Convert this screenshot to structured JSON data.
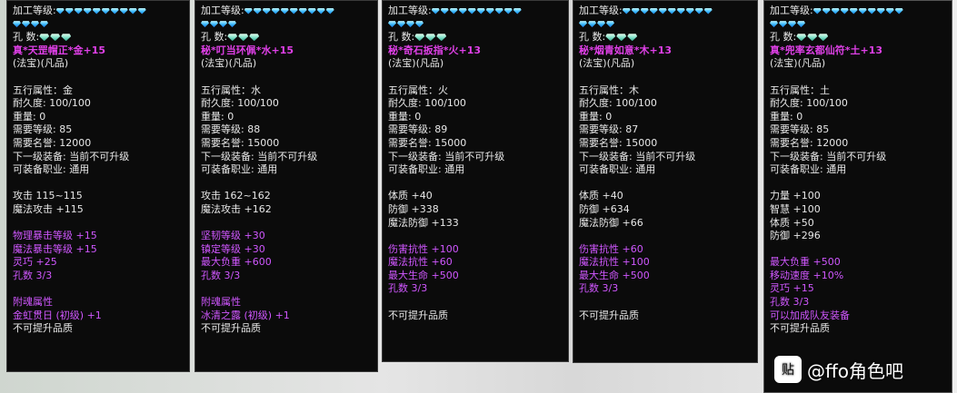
{
  "panels": [
    {
      "gem_count_row1": 10,
      "gem_count_row2": 4,
      "hole_gems": 3,
      "lines": [
        {
          "t": "加工等级:",
          "gems": "top"
        },
        {
          "t": "",
          "gems": "top2"
        },
        {
          "t": "孔    数:",
          "gems": "hole"
        },
        {
          "t": "真*天罡帽正*金+15",
          "c": "name"
        },
        {
          "t": "(法宝)(凡品)"
        },
        {
          "t": ""
        },
        {
          "t": "五行属性：金"
        },
        {
          "t": "耐久度: 100/100"
        },
        {
          "t": "重量: 0"
        },
        {
          "t": "需要等级: 85"
        },
        {
          "t": "需要名誉: 12000"
        },
        {
          "t": "下一级装备: 当前不可升级"
        },
        {
          "t": "可装备职业: 通用"
        },
        {
          "t": ""
        },
        {
          "t": "攻击 115~115"
        },
        {
          "t": "魔法攻击 +115"
        },
        {
          "t": ""
        },
        {
          "t": "物理暴击等级 +15",
          "c": "purple"
        },
        {
          "t": "魔法暴击等级 +15",
          "c": "purple"
        },
        {
          "t": "灵巧        +25",
          "c": "purple"
        },
        {
          "t": "孔数 3/3",
          "c": "purple"
        },
        {
          "t": ""
        },
        {
          "t": "附魂属性",
          "c": "purple"
        },
        {
          "t": "  金虹贯日 (初级) +1",
          "c": "purple"
        },
        {
          "t": "不可提升品质"
        }
      ]
    },
    {
      "gem_count_row1": 10,
      "gem_count_row2": 4,
      "hole_gems": 3,
      "lines": [
        {
          "t": "加工等级:",
          "gems": "top"
        },
        {
          "t": "",
          "gems": "top2"
        },
        {
          "t": "孔    数:",
          "gems": "hole"
        },
        {
          "t": "秘*叮当环佩*水+15",
          "c": "name"
        },
        {
          "t": "(法宝)(凡品)"
        },
        {
          "t": ""
        },
        {
          "t": "五行属性：水"
        },
        {
          "t": "耐久度: 100/100"
        },
        {
          "t": "重量: 0"
        },
        {
          "t": "需要等级: 88"
        },
        {
          "t": "需要名誉: 15000"
        },
        {
          "t": "下一级装备: 当前不可升级"
        },
        {
          "t": "可装备职业: 通用"
        },
        {
          "t": ""
        },
        {
          "t": "攻击 162~162"
        },
        {
          "t": "魔法攻击 +162"
        },
        {
          "t": ""
        },
        {
          "t": "坚韧等级 +30",
          "c": "purple"
        },
        {
          "t": "镇定等级 +30",
          "c": "purple"
        },
        {
          "t": "最大负重 +600",
          "c": "purple"
        },
        {
          "t": "孔数 3/3",
          "c": "purple"
        },
        {
          "t": ""
        },
        {
          "t": "附魂属性",
          "c": "purple"
        },
        {
          "t": "  冰清之露 (初级) +1",
          "c": "purple"
        },
        {
          "t": "不可提升品质"
        }
      ]
    },
    {
      "gem_count_row1": 10,
      "gem_count_row2": 4,
      "hole_gems": 3,
      "lines": [
        {
          "t": "加工等级:",
          "gems": "top"
        },
        {
          "t": "",
          "gems": "top2"
        },
        {
          "t": "孔    数:",
          "gems": "hole"
        },
        {
          "t": "秘*奇石扳指*火+13",
          "c": "name"
        },
        {
          "t": "(法宝)(凡品)"
        },
        {
          "t": ""
        },
        {
          "t": "五行属性：火"
        },
        {
          "t": "耐久度: 100/100"
        },
        {
          "t": "重量: 0"
        },
        {
          "t": "需要等级: 89"
        },
        {
          "t": "需要名誉: 15000"
        },
        {
          "t": "下一级装备: 当前不可升级"
        },
        {
          "t": "可装备职业: 通用"
        },
        {
          "t": ""
        },
        {
          "t": "体质 +40"
        },
        {
          "t": "防御 +338"
        },
        {
          "t": "魔法防御 +133"
        },
        {
          "t": ""
        },
        {
          "t": "伤害抗性 +100",
          "c": "purple"
        },
        {
          "t": "魔法抗性 +60",
          "c": "purple"
        },
        {
          "t": "最大生命 +500",
          "c": "purple"
        },
        {
          "t": "孔数 3/3",
          "c": "purple"
        },
        {
          "t": ""
        },
        {
          "t": "不可提升品质"
        }
      ]
    },
    {
      "gem_count_row1": 10,
      "gem_count_row2": 4,
      "hole_gems": 3,
      "lines": [
        {
          "t": "加工等级:",
          "gems": "top"
        },
        {
          "t": "",
          "gems": "top2"
        },
        {
          "t": "孔    数:",
          "gems": "hole"
        },
        {
          "t": "秘*烟青如意*木+13",
          "c": "name"
        },
        {
          "t": "(法宝)(凡品)"
        },
        {
          "t": ""
        },
        {
          "t": "五行属性：木"
        },
        {
          "t": "耐久度: 100/100"
        },
        {
          "t": "重量: 0"
        },
        {
          "t": "需要等级: 87"
        },
        {
          "t": "需要名誉: 15000"
        },
        {
          "t": "下一级装备: 当前不可升级"
        },
        {
          "t": "可装备职业: 通用"
        },
        {
          "t": ""
        },
        {
          "t": "体质 +40"
        },
        {
          "t": "防御 +634"
        },
        {
          "t": "魔法防御 +66"
        },
        {
          "t": ""
        },
        {
          "t": "伤害抗性 +60",
          "c": "purple"
        },
        {
          "t": "魔法抗性 +100",
          "c": "purple"
        },
        {
          "t": "最大生命 +500",
          "c": "purple"
        },
        {
          "t": "孔数 3/3",
          "c": "purple"
        },
        {
          "t": ""
        },
        {
          "t": "不可提升品质"
        }
      ]
    },
    {
      "gem_count_row1": 10,
      "gem_count_row2": 4,
      "hole_gems": 3,
      "lines": [
        {
          "t": "加工等级:",
          "gems": "top"
        },
        {
          "t": "",
          "gems": "top2"
        },
        {
          "t": "孔    数:",
          "gems": "hole"
        },
        {
          "t": "真*兜率玄都仙符*土+13",
          "c": "name"
        },
        {
          "t": "(法宝)(凡品)"
        },
        {
          "t": ""
        },
        {
          "t": "五行属性：土"
        },
        {
          "t": "耐久度: 100/100"
        },
        {
          "t": "重量: 0"
        },
        {
          "t": "需要等级: 85"
        },
        {
          "t": "需要名誉: 12000"
        },
        {
          "t": "下一级装备: 当前不可升级"
        },
        {
          "t": "可装备职业: 通用"
        },
        {
          "t": ""
        },
        {
          "t": "力量 +100"
        },
        {
          "t": "智慧 +100"
        },
        {
          "t": "体质 +50"
        },
        {
          "t": "防御 +296"
        },
        {
          "t": ""
        },
        {
          "t": "最大负重 +500",
          "c": "purple"
        },
        {
          "t": "移动速度 +10%",
          "c": "purple"
        },
        {
          "t": "灵巧        +15",
          "c": "purple"
        },
        {
          "t": "孔数 3/3",
          "c": "purple"
        },
        {
          "t": "可以加成队友装备",
          "c": "purple"
        },
        {
          "t": "不可提升品质"
        }
      ]
    }
  ],
  "watermark": {
    "icon": "贴",
    "text": "@ffo角色吧"
  }
}
